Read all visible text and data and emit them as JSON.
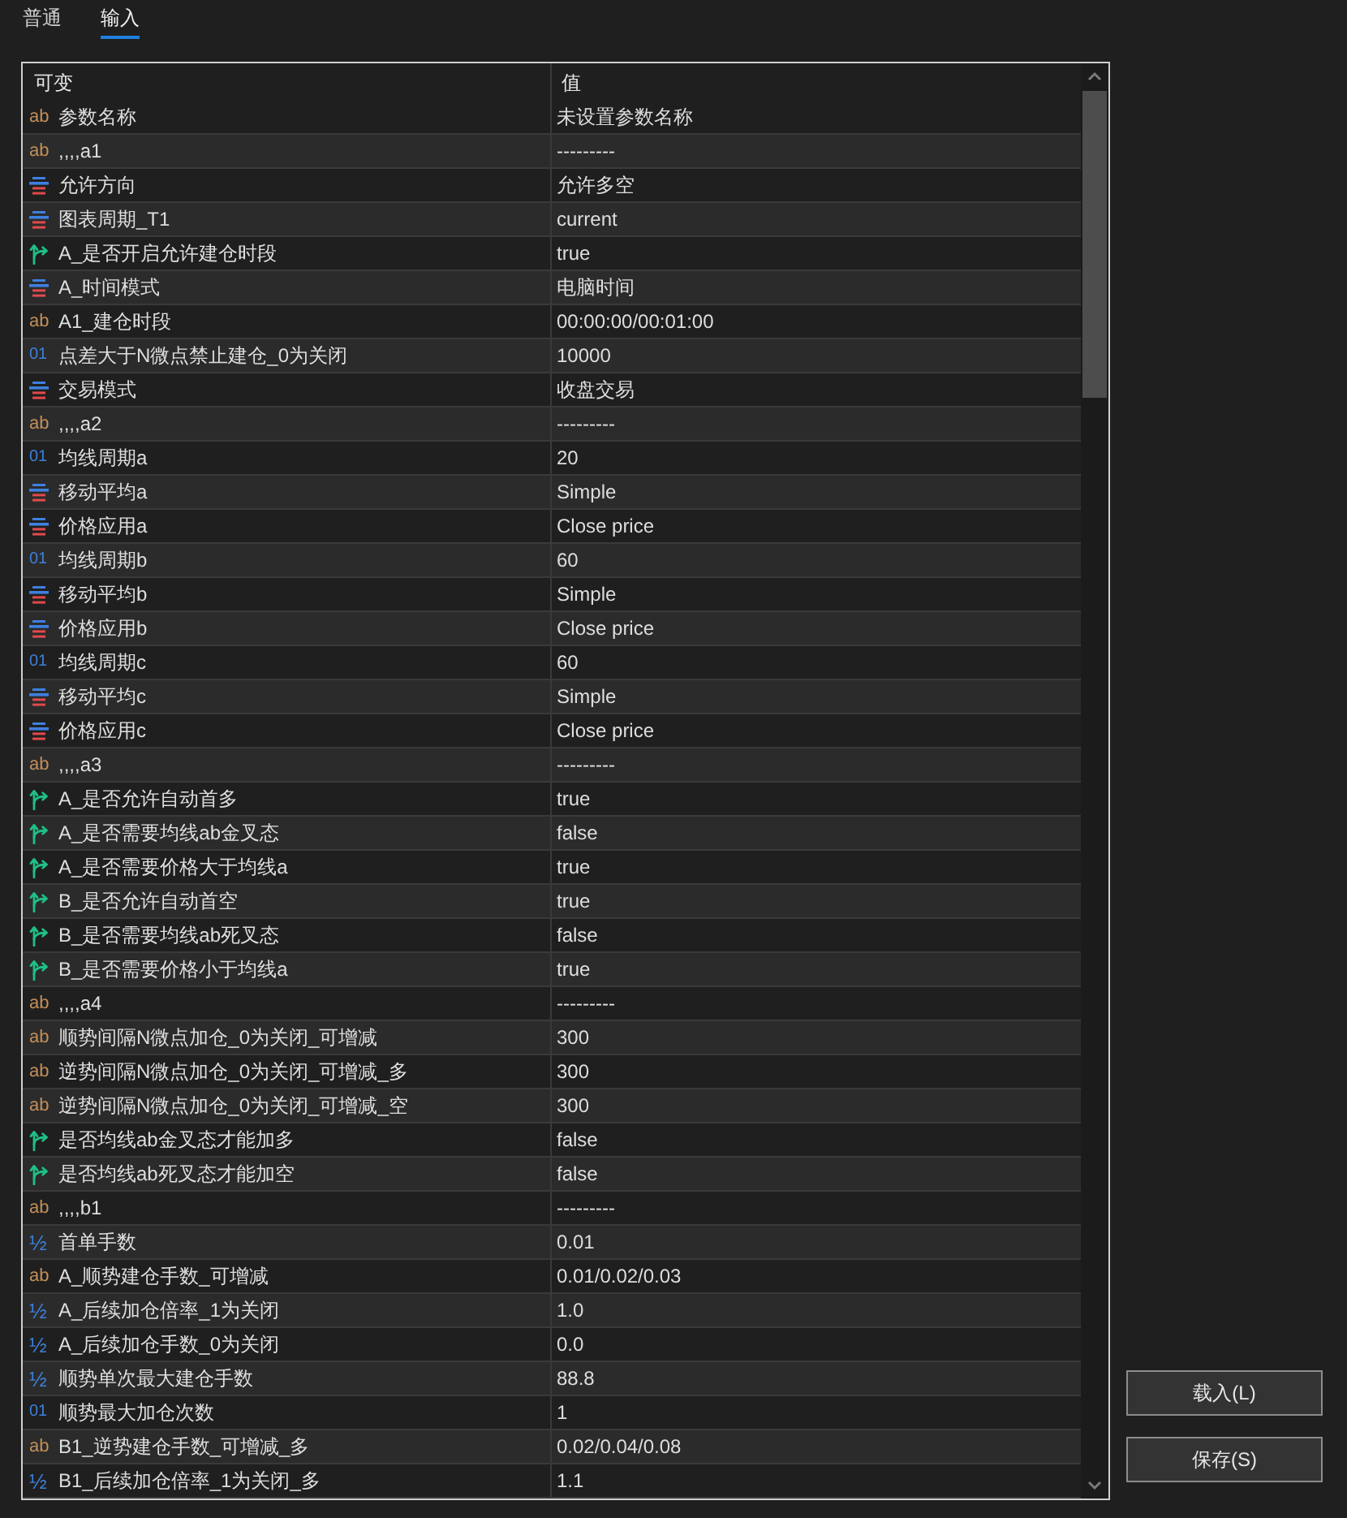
{
  "tabs": [
    {
      "label": "普通",
      "selected": false
    },
    {
      "label": "输入",
      "selected": true
    }
  ],
  "table": {
    "columns": [
      "可变",
      "值"
    ],
    "rows": [
      {
        "kind": "string",
        "glyph": "ab",
        "name": "参数名称",
        "value": "未设置参数名称"
      },
      {
        "kind": "string",
        "glyph": "ab",
        "name": ",,,,a1",
        "value": "---------"
      },
      {
        "kind": "enum",
        "name": "允许方向",
        "value": "允许多空"
      },
      {
        "kind": "enum",
        "name": "图表周期_T1",
        "value": "current"
      },
      {
        "kind": "bool",
        "name": "A_是否开启允许建仓时段",
        "value": "true"
      },
      {
        "kind": "enum",
        "name": "A_时间模式",
        "value": "电脑时间"
      },
      {
        "kind": "string",
        "glyph": "ab",
        "name": "A1_建仓时段",
        "value": "00:00:00/00:01:00"
      },
      {
        "kind": "int",
        "glyph": "01",
        "name": "点差大于N微点禁止建仓_0为关闭",
        "value": "10000"
      },
      {
        "kind": "enum",
        "name": "交易模式",
        "value": "收盘交易"
      },
      {
        "kind": "string",
        "glyph": "ab",
        "name": ",,,,a2",
        "value": "---------"
      },
      {
        "kind": "int",
        "glyph": "01",
        "name": "均线周期a",
        "value": "20"
      },
      {
        "kind": "enum",
        "name": "移动平均a",
        "value": "Simple"
      },
      {
        "kind": "enum",
        "name": "价格应用a",
        "value": "Close price"
      },
      {
        "kind": "int",
        "glyph": "01",
        "name": "均线周期b",
        "value": "60"
      },
      {
        "kind": "enum",
        "name": "移动平均b",
        "value": "Simple"
      },
      {
        "kind": "enum",
        "name": "价格应用b",
        "value": "Close price"
      },
      {
        "kind": "int",
        "glyph": "01",
        "name": "均线周期c",
        "value": "60"
      },
      {
        "kind": "enum",
        "name": "移动平均c",
        "value": "Simple"
      },
      {
        "kind": "enum",
        "name": "价格应用c",
        "value": "Close price"
      },
      {
        "kind": "string",
        "glyph": "ab",
        "name": ",,,,a3",
        "value": "---------"
      },
      {
        "kind": "bool",
        "name": "A_是否允许自动首多",
        "value": "true"
      },
      {
        "kind": "bool",
        "name": "A_是否需要均线ab金叉态",
        "value": "false"
      },
      {
        "kind": "bool",
        "name": "A_是否需要价格大于均线a",
        "value": "true"
      },
      {
        "kind": "bool",
        "name": "B_是否允许自动首空",
        "value": "true"
      },
      {
        "kind": "bool",
        "name": "B_是否需要均线ab死叉态",
        "value": "false"
      },
      {
        "kind": "bool",
        "name": "B_是否需要价格小于均线a",
        "value": "true"
      },
      {
        "kind": "string",
        "glyph": "ab",
        "name": ",,,,a4",
        "value": "---------"
      },
      {
        "kind": "string",
        "glyph": "ab",
        "name": "顺势间隔N微点加仓_0为关闭_可增减",
        "value": "300"
      },
      {
        "kind": "string",
        "glyph": "ab",
        "name": "逆势间隔N微点加仓_0为关闭_可增减_多",
        "value": "300"
      },
      {
        "kind": "string",
        "glyph": "ab",
        "name": "逆势间隔N微点加仓_0为关闭_可增减_空",
        "value": "300"
      },
      {
        "kind": "bool",
        "name": "是否均线ab金叉态才能加多",
        "value": "false"
      },
      {
        "kind": "bool",
        "name": "是否均线ab死叉态才能加空",
        "value": "false"
      },
      {
        "kind": "string",
        "glyph": "ab",
        "name": ",,,,b1",
        "value": "---------"
      },
      {
        "kind": "double",
        "glyph": "½",
        "name": "首单手数",
        "value": "0.01"
      },
      {
        "kind": "string",
        "glyph": "ab",
        "name": "A_顺势建仓手数_可增减",
        "value": "0.01/0.02/0.03"
      },
      {
        "kind": "double",
        "glyph": "½",
        "name": "A_后续加仓倍率_1为关闭",
        "value": "1.0"
      },
      {
        "kind": "double",
        "glyph": "½",
        "name": "A_后续加仓手数_0为关闭",
        "value": "0.0"
      },
      {
        "kind": "double",
        "glyph": "½",
        "name": "顺势单次最大建仓手数",
        "value": "88.8"
      },
      {
        "kind": "int",
        "glyph": "01",
        "name": "顺势最大加仓次数",
        "value": "1"
      },
      {
        "kind": "string",
        "glyph": "ab",
        "name": "B1_逆势建仓手数_可增减_多",
        "value": "0.02/0.04/0.08"
      },
      {
        "kind": "double",
        "glyph": "½",
        "name": "B1_后续加仓倍率_1为关闭_多",
        "value": "1.1"
      }
    ]
  },
  "buttons": [
    "载入(L)",
    "保存(S)"
  ]
}
